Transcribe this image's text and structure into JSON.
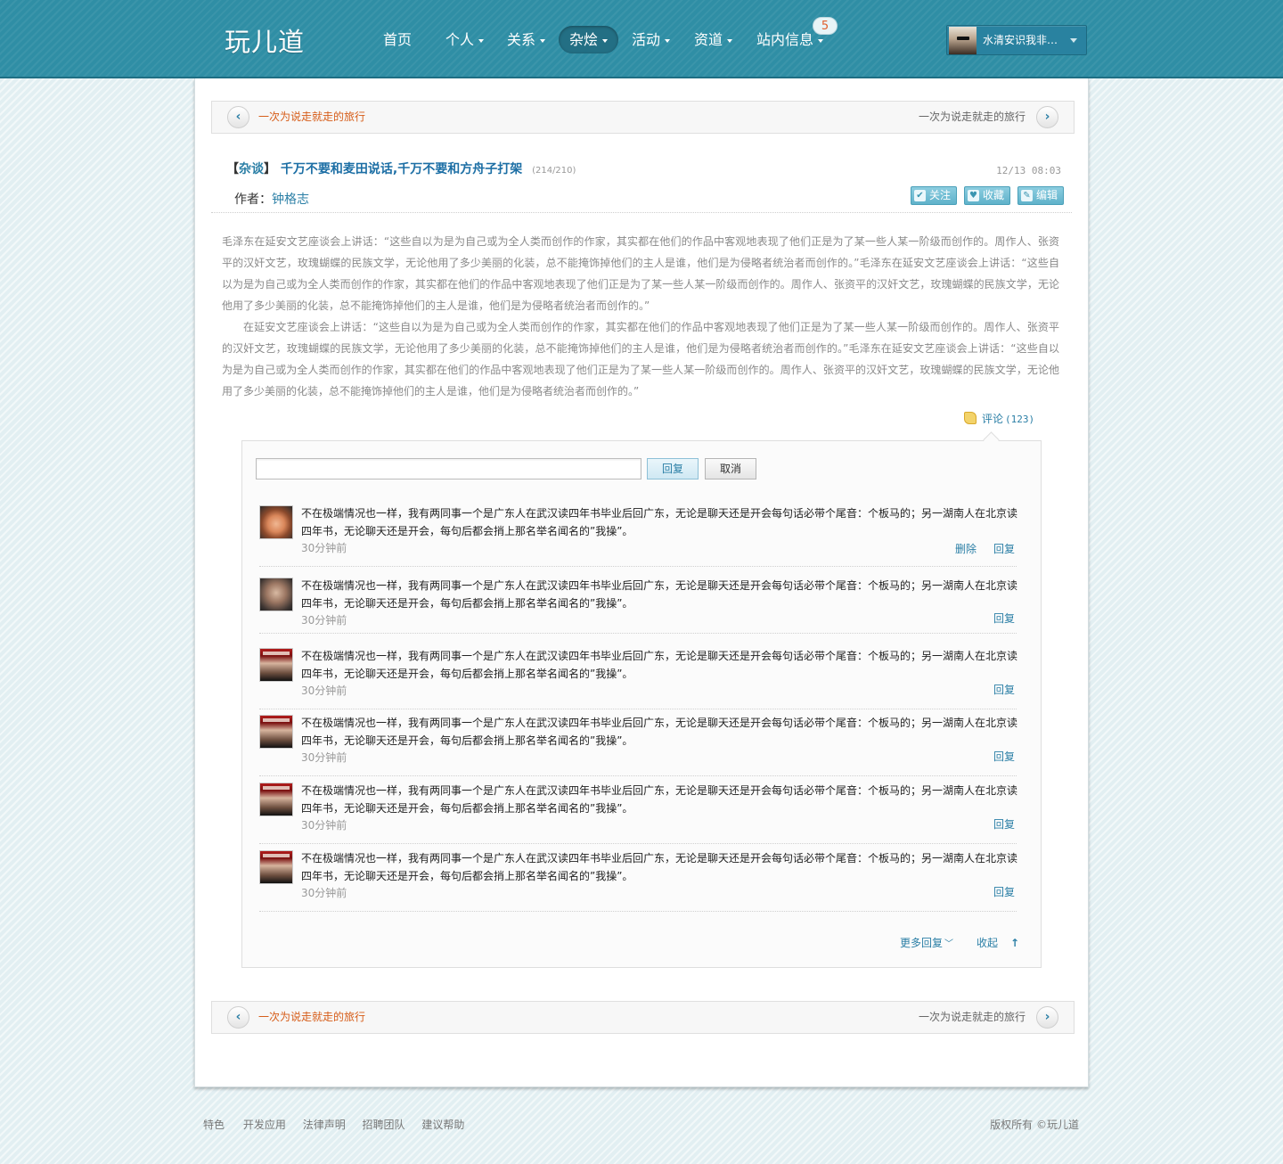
{
  "header": {
    "logo": "玩儿道",
    "nav": [
      {
        "label": "首页",
        "caret": false
      },
      {
        "label": "个人",
        "caret": true
      },
      {
        "label": "关系",
        "caret": true
      },
      {
        "label": "杂烩",
        "caret": true,
        "active": true
      },
      {
        "label": "活动",
        "caret": true
      },
      {
        "label": "资道",
        "caret": true
      },
      {
        "label": "站内信息",
        "caret": true
      }
    ],
    "message_count": "5",
    "user_name": "水清安识我非…"
  },
  "pager": {
    "prev_label": "一次为说走就走的旅行",
    "next_label": "一次为说走就走的旅行"
  },
  "post": {
    "bracket_open": "【",
    "category": "杂谈",
    "bracket_close": "】",
    "title": "千万不要和麦田说话,千万不要和方舟子打架",
    "counts": "(214/210)",
    "date": "12/13 08:03",
    "author_label": "作者：",
    "author_name": "钟格志",
    "actions": {
      "follow": "关注",
      "favorite": "收藏",
      "edit": "编辑"
    },
    "paragraphs": [
      "毛泽东在延安文艺座谈会上讲话：“这些自以为是为自己或为全人类而创作的作家，其实都在他们的作品中客观地表现了他们正是为了某一些人某一阶级而创作的。周作人、张资平的汉奸文艺，玫瑰蝴蝶的民族文学，无论他用了多少美丽的化装，总不能掩饰掉他们的主人是谁，他们是为侵略者统治者而创作的。”毛泽东在延安文艺座谈会上讲话：“这些自以为是为自己或为全人类而创作的作家，其实都在他们的作品中客观地表现了他们正是为了某一些人某一阶级而创作的。周作人、张资平的汉奸文艺，玫瑰蝴蝶的民族文学，无论他用了多少美丽的化装，总不能掩饰掉他们的主人是谁，他们是为侵略者统治者而创作的。”",
      "在延安文艺座谈会上讲话：“这些自以为是为自己或为全人类而创作的作家，其实都在他们的作品中客观地表现了他们正是为了某一些人某一阶级而创作的。周作人、张资平的汉奸文艺，玫瑰蝴蝶的民族文学，无论他用了多少美丽的化装，总不能掩饰掉他们的主人是谁，他们是为侵略者统治者而创作的。”毛泽东在延安文艺座谈会上讲话：“这些自以为是为自己或为全人类而创作的作家，其实都在他们的作品中客观地表现了他们正是为了某一些人某一阶级而创作的。周作人、张资平的汉奸文艺，玫瑰蝴蝶的民族文学，无论他用了多少美丽的化装，总不能掩饰掉他们的主人是谁，他们是为侵略者统治者而创作的。”"
    ],
    "comment_label": "评论",
    "comment_count": "(123)"
  },
  "comments": {
    "reply_button": "回复",
    "cancel_button": "取消",
    "items": [
      {
        "text": "不在极端情况也一样，我有两同事一个是广东人在武汉读四年书毕业后回广东，无论是聊天还是开会每句话必带个尾音：个板马的；另一湖南人在北京读四年书，无论聊天还是开会，每句后都会捎上那名举名闻名的”我操”。",
        "time": "30分钟前",
        "delete": "删除",
        "reply": "回复"
      },
      {
        "text": "不在极端情况也一样，我有两同事一个是广东人在武汉读四年书毕业后回广东，无论是聊天还是开会每句话必带个尾音：个板马的；另一湖南人在北京读四年书，无论聊天还是开会，每句后都会捎上那名举名闻名的”我操”。",
        "time": "30分钟前",
        "reply": "回复"
      },
      {
        "text": "不在极端情况也一样，我有两同事一个是广东人在武汉读四年书毕业后回广东，无论是聊天还是开会每句话必带个尾音：个板马的；另一湖南人在北京读四年书，无论聊天还是开会，每句后都会捎上那名举名闻名的”我操”。",
        "time": "30分钟前",
        "reply": "回复"
      },
      {
        "text": "不在极端情况也一样，我有两同事一个是广东人在武汉读四年书毕业后回广东，无论是聊天还是开会每句话必带个尾音：个板马的；另一湖南人在北京读四年书，无论聊天还是开会，每句后都会捎上那名举名闻名的”我操”。",
        "time": "30分钟前",
        "reply": "回复"
      },
      {
        "text": "不在极端情况也一样，我有两同事一个是广东人在武汉读四年书毕业后回广东，无论是聊天还是开会每句话必带个尾音：个板马的；另一湖南人在北京读四年书，无论聊天还是开会，每句后都会捎上那名举名闻名的”我操”。",
        "time": "30分钟前",
        "reply": "回复"
      },
      {
        "text": "不在极端情况也一样，我有两同事一个是广东人在武汉读四年书毕业后回广东，无论是聊天还是开会每句话必带个尾音：个板马的；另一湖南人在北京读四年书，无论聊天还是开会，每句后都会捎上那名举名闻名的”我操”。",
        "time": "30分钟前",
        "reply": "回复"
      }
    ],
    "more_label": "更多回复",
    "collapse_label": "收起"
  },
  "footer": {
    "links": [
      "特色",
      "开发应用",
      "法律声明",
      "招聘团队",
      "建议帮助"
    ],
    "copyright": "版权所有 ©玩儿道"
  }
}
